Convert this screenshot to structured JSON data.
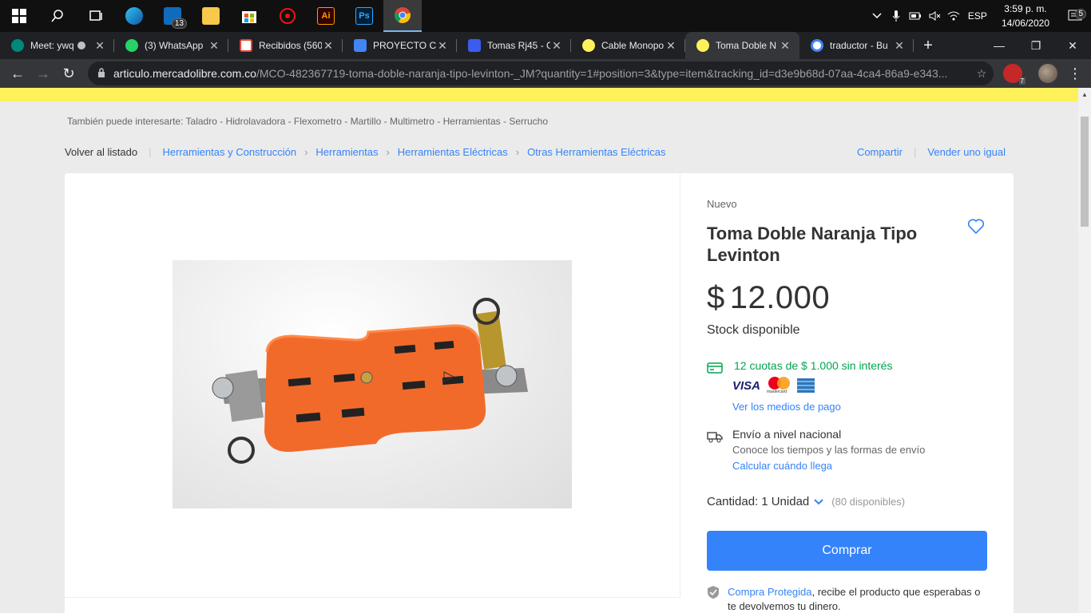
{
  "taskbar": {
    "mail_badge": "13",
    "apps": [
      "start-icon",
      "search-icon",
      "task-view-icon",
      "edge-icon",
      "mail-icon",
      "file-explorer-icon",
      "store-icon",
      "app-red-icon",
      "illustrator-icon",
      "photoshop-icon",
      "chrome-icon"
    ],
    "illustrator_label": "Ai",
    "photoshop_label": "Ps",
    "lang": "ESP",
    "time": "3:59 p. m.",
    "date": "14/06/2020",
    "notif_count": "5"
  },
  "tabs": [
    {
      "label": "Meet: ywq",
      "color": "#00897b"
    },
    {
      "label": "(3) WhatsApp",
      "color": "#25d366"
    },
    {
      "label": "Recibidos (560",
      "color": "#ea4335"
    },
    {
      "label": "PROYECTO CA",
      "color": "#4285f4"
    },
    {
      "label": "Tomas Rj45 - C",
      "color": "#3b5cf0"
    },
    {
      "label": "Cable Monopo",
      "color": "#fff159"
    },
    {
      "label": "Toma Doble N",
      "color": "#fff159"
    },
    {
      "label": "traductor - Bu",
      "color": "#ffffff"
    }
  ],
  "address": {
    "host": "articulo.mercadolibre.com.co",
    "path": "/MCO-482367719-toma-doble-naranja-tipo-levinton-_JM?quantity=1#position=3&type=item&tracking_id=d3e9b68d-07aa-4ca4-86a9-e343..."
  },
  "extension_badge": "7",
  "page": {
    "also": "También puede interesarte: Taladro - Hidrolavadora - Flexometro - Martillo - Multimetro - Herramientas - Serrucho",
    "back": "Volver al listado",
    "crumbs": [
      "Herramientas y Construcción",
      "Herramientas",
      "Herramientas Eléctricas",
      "Otras Herramientas Eléctricas"
    ],
    "share": "Compartir",
    "sell": "Vender uno igual",
    "condition": "Nuevo",
    "title": "Toma Doble Naranja Tipo Levinton",
    "price_currency": "$",
    "price_value": "12.000",
    "stock": "Stock disponible",
    "installments": "12 cuotas de $ 1.000 sin interés",
    "card_visa": "VISA",
    "card_mc": "mastercard",
    "payment_link": "Ver los medios de pago",
    "shipping_title": "Envío a nivel nacional",
    "shipping_sub": "Conoce los tiempos y las formas de envío",
    "shipping_link": "Calcular cuándo llega",
    "qty_label": "Cantidad:",
    "qty_value": "1 Unidad",
    "qty_available": "(80 disponibles)",
    "buy_label": "Comprar",
    "protected_link": "Compra Protegida",
    "protected_text": ", recibe el producto que esperabas o te devolvemos tu dinero."
  },
  "colors": {
    "brand_yellow": "#fff159",
    "link_blue": "#3483fa",
    "success_green": "#00a650",
    "outlet_orange": "#f26a2a"
  }
}
